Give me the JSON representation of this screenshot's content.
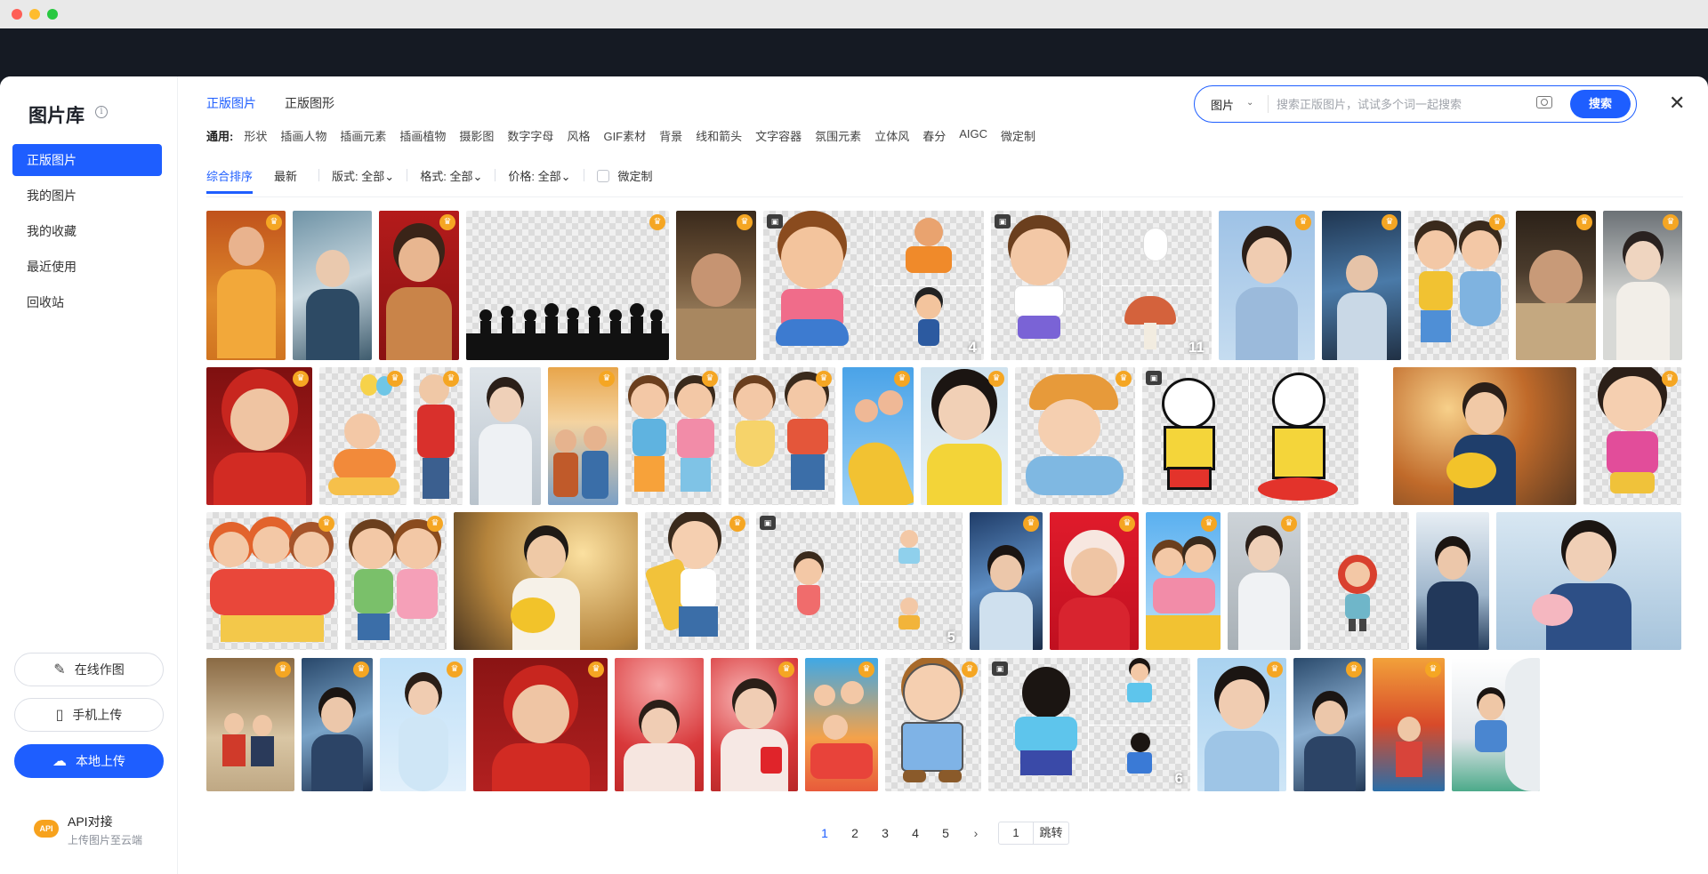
{
  "sidebar": {
    "title": "图片库",
    "nav": [
      {
        "label": "正版图片",
        "active": true
      },
      {
        "label": "我的图片",
        "active": false
      },
      {
        "label": "我的收藏",
        "active": false
      },
      {
        "label": "最近使用",
        "active": false
      },
      {
        "label": "回收站",
        "active": false
      }
    ],
    "online_label": "在线作图",
    "phone_label": "手机上传",
    "local_label": "本地上传",
    "api_badge": "API",
    "api_title": "API对接",
    "api_sub": "上传图片至云端"
  },
  "header": {
    "tabs": [
      {
        "label": "正版图片",
        "active": true
      },
      {
        "label": "正版图形",
        "active": false
      }
    ],
    "search": {
      "category": "图片",
      "placeholder": "搜索正版图片，试试多个词一起搜索",
      "button": "搜索"
    },
    "close": "✕"
  },
  "tags": {
    "label": "通用:",
    "items": [
      "形状",
      "插画人物",
      "插画元素",
      "插画植物",
      "摄影图",
      "数字字母",
      "风格",
      "GIF素材",
      "背景",
      "线和箭头",
      "文字容器",
      "氛围元素",
      "立体风",
      "春分",
      "AIGC",
      "微定制"
    ]
  },
  "sort": {
    "options": [
      {
        "label": "综合排序",
        "active": true
      },
      {
        "label": "最新",
        "active": false
      }
    ],
    "layout_label": "版式:",
    "layout_value": "全部",
    "format_label": "格式:",
    "format_value": "全部",
    "price_label": "价格:",
    "price_value": "全部",
    "custom_label": "微定制"
  },
  "grid": {
    "set_counts": [
      "4",
      "11",
      "5",
      "6"
    ]
  },
  "pagination": {
    "pages": [
      "1",
      "2",
      "3",
      "4",
      "5"
    ],
    "current": "1",
    "next": "›",
    "jump_value": "1",
    "jump_label": "跳转"
  },
  "colors": {
    "accent": "#1e5eff",
    "premium_badge": "#f5a623"
  }
}
